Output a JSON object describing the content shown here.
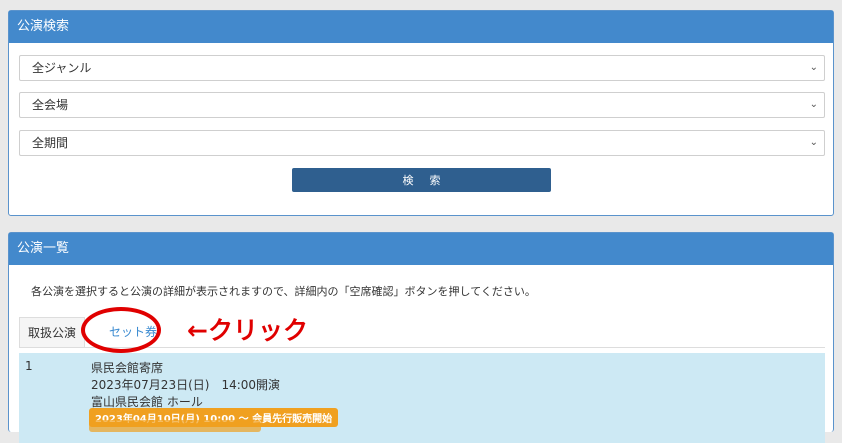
{
  "search_panel": {
    "title": "公演検索",
    "genre_select": {
      "selected": "全ジャンル"
    },
    "venue_select": {
      "selected": "全会場"
    },
    "period_select": {
      "selected": "全期間"
    },
    "search_label": "検索"
  },
  "list_panel": {
    "title": "公演一覧",
    "instruction": "各公演を選択すると公演の詳細が表示されますので、詳細内の「空席確認」ボタンを押してください。",
    "tabs": [
      {
        "label": "取扱公演"
      },
      {
        "label": "セット券"
      }
    ],
    "annotation": "←クリック",
    "rows": [
      {
        "num": "1",
        "title": "県民会館寄席",
        "datetime": "2023年07月23日(日)　14:00開演",
        "venue": "富山県民会館 ホール",
        "badge": "2023年04月10日(月) 10:00 ～ 会員先行販売開始"
      }
    ]
  },
  "colors": {
    "header_blue": "#4389cc",
    "button_navy": "#2f5f8f",
    "tab_link": "#3a8ad0",
    "row_bg": "#cde9f4",
    "badge_orange": "#f0a020",
    "annotation_red": "#e00000"
  }
}
